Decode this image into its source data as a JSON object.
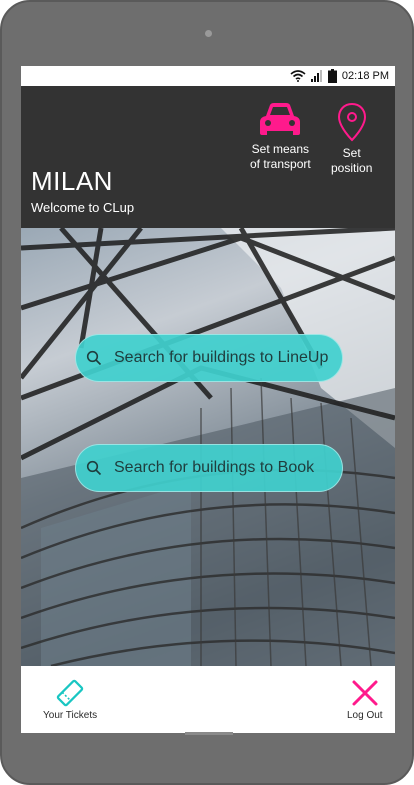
{
  "status": {
    "time": "02:18 PM"
  },
  "header": {
    "city": "MILAN",
    "welcome": "Welcome to CLup",
    "transport_label": "Set means\nof transport",
    "position_label": "Set\nposition",
    "accent_color": "#ff1a8c"
  },
  "main": {
    "search_lineup_label": "Search for buildings to LineUp",
    "search_book_label": "Search for buildings to Book",
    "button_color": "#40d0ce"
  },
  "bottom": {
    "tickets_label": "Your Tickets",
    "logout_label": "Log Out"
  },
  "icons": [
    "camera-dot",
    "wifi-icon",
    "signal-icon",
    "battery-icon",
    "car-icon",
    "location-pin-icon",
    "search-icon",
    "ticket-icon",
    "close-icon"
  ]
}
